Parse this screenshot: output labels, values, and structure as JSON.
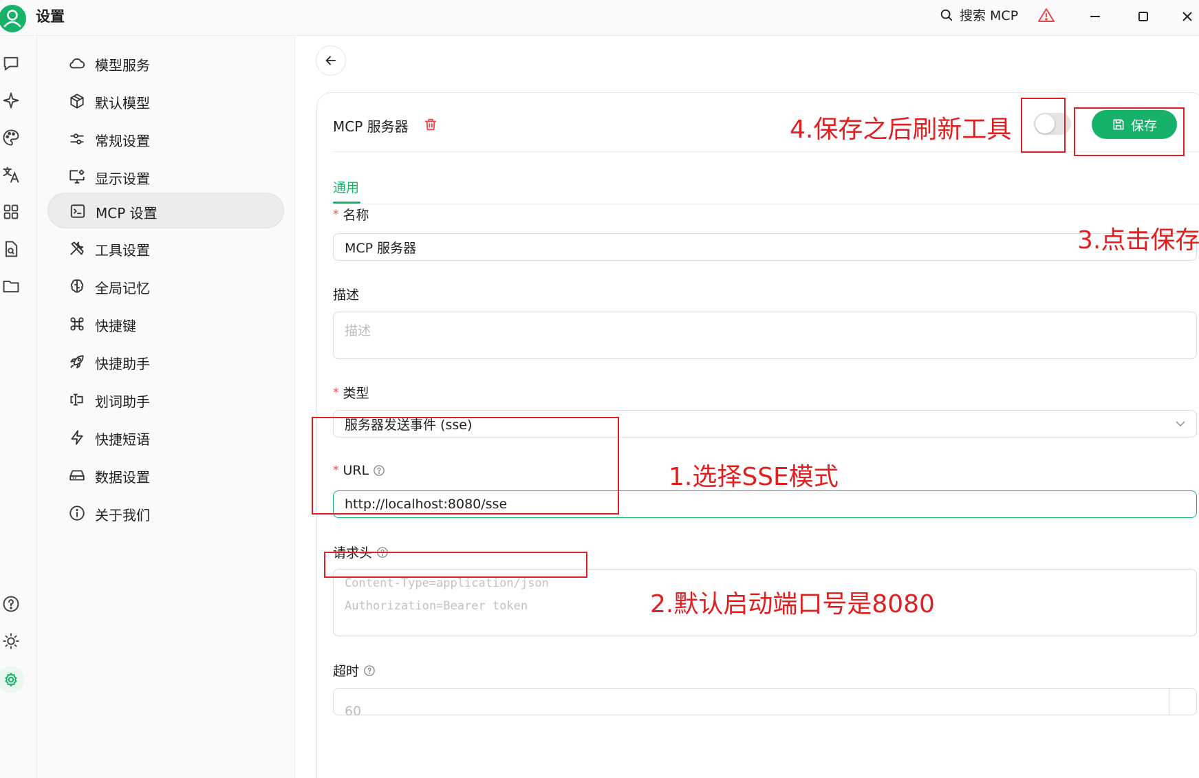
{
  "app": {
    "title": "设置"
  },
  "titlebar": {
    "search_label": "搜索 MCP"
  },
  "nav": {
    "items": [
      {
        "label": "模型服务",
        "icon": "cloud-icon"
      },
      {
        "label": "默认模型",
        "icon": "cube-icon"
      },
      {
        "label": "常规设置",
        "icon": "sliders-icon"
      },
      {
        "label": "显示设置",
        "icon": "monitor-settings-icon"
      },
      {
        "label": "MCP 设置",
        "icon": "terminal-icon",
        "active": true
      },
      {
        "label": "工具设置",
        "icon": "tools-icon"
      },
      {
        "label": "全局记忆",
        "icon": "brain-icon"
      },
      {
        "label": "快捷键",
        "icon": "command-icon"
      },
      {
        "label": "快捷助手",
        "icon": "rocket-icon"
      },
      {
        "label": "划词助手",
        "icon": "text-select-icon"
      },
      {
        "label": "快捷短语",
        "icon": "zap-icon"
      },
      {
        "label": "数据设置",
        "icon": "hard-drive-icon"
      },
      {
        "label": "关于我们",
        "icon": "info-icon"
      }
    ]
  },
  "server": {
    "title": "MCP 服务器",
    "save_label": "保存",
    "enabled": false,
    "tab_general": "通用",
    "name_label": "名称",
    "name_value": "MCP 服务器",
    "desc_label": "描述",
    "desc_placeholder": "描述",
    "type_label": "类型",
    "type_value": "服务器发送事件 (sse)",
    "url_label": "URL",
    "url_value": "http://localhost:8080/sse",
    "headers_label": "请求头",
    "headers_placeholder_1": "Content-Type=application/json",
    "headers_placeholder_2": "Authorization=Bearer token",
    "timeout_label": "超时",
    "timeout_placeholder": "60"
  },
  "annotations": {
    "a1": "1.选择SSE模式",
    "a2": "2.默认启动端口号是8080",
    "a3": "3.点击保存",
    "a4": "4.保存之后刷新工具"
  },
  "colors": {
    "accent": "#17b26a",
    "annotation": "#e02020",
    "danger": "#e5484d"
  }
}
